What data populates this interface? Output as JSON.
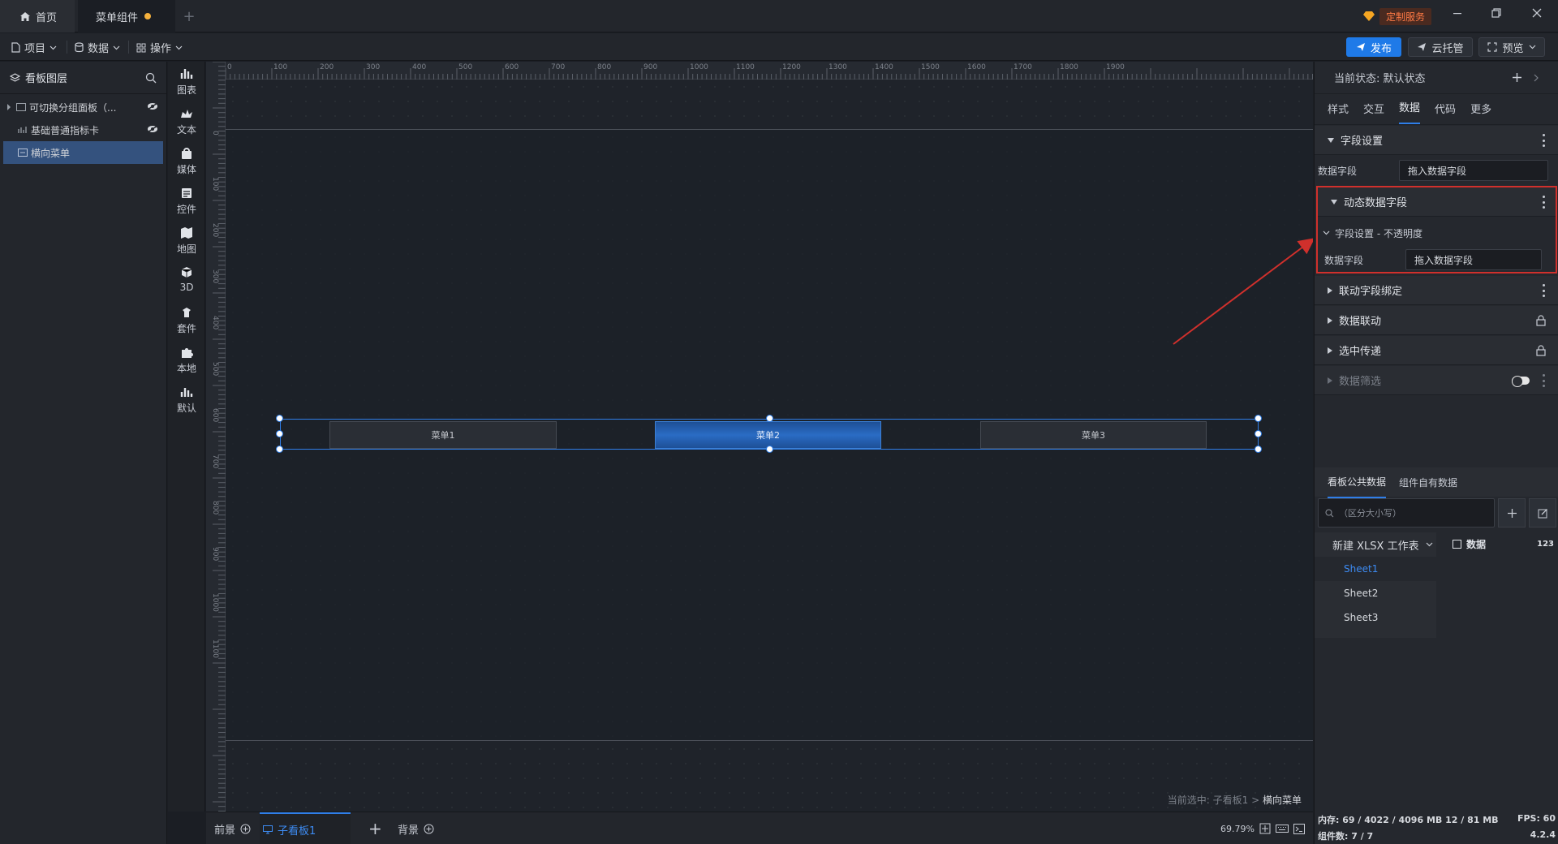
{
  "tabs": {
    "home": "首页",
    "menu": "菜单组件",
    "add": "+"
  },
  "titlebar": {
    "custom_service": "定制服务"
  },
  "toolbar": {
    "project": "项目",
    "data": "数据",
    "operate": "操作",
    "publish": "发布",
    "cloud": "云托管",
    "preview": "预览"
  },
  "layers": {
    "title": "看板图层",
    "items": [
      {
        "label": "可切换分组面板（..."
      },
      {
        "label": "基础普通指标卡"
      },
      {
        "label": "横向菜单"
      }
    ]
  },
  "rail": {
    "items": [
      {
        "label": "图表",
        "icon": "bar-chart-icon"
      },
      {
        "label": "文本",
        "icon": "text-icon"
      },
      {
        "label": "媒体",
        "icon": "media-icon"
      },
      {
        "label": "控件",
        "icon": "control-icon"
      },
      {
        "label": "地图",
        "icon": "map-icon"
      },
      {
        "label": "3D",
        "icon": "cube-icon"
      },
      {
        "label": "套件",
        "icon": "kit-icon"
      },
      {
        "label": "本地",
        "icon": "puzzle-icon"
      },
      {
        "label": "默认",
        "icon": "default-chart-icon"
      }
    ]
  },
  "ruler": {
    "top": [
      "0",
      "100",
      "200",
      "300",
      "400",
      "500",
      "600",
      "700",
      "800",
      "900",
      "1000",
      "1100",
      "1200",
      "1300",
      "1400",
      "1500",
      "1600",
      "1700",
      "1800",
      "1900"
    ],
    "left": [
      "0",
      "100",
      "200",
      "300",
      "400",
      "500",
      "600",
      "700",
      "800",
      "900",
      "1000",
      "1100"
    ]
  },
  "canvas": {
    "menu_items": [
      "菜单1",
      "菜单2",
      "菜单3"
    ],
    "active_index": 1,
    "breadcrumb_prefix": "当前选中: 子看板1 > ",
    "breadcrumb_current": "横向菜单"
  },
  "bottom": {
    "foreground": "前景",
    "sub_board": "子看板1",
    "add": "+",
    "background": "背景",
    "zoom": "69.79%"
  },
  "right": {
    "state_label": "当前状态: 默认状态",
    "tabs": [
      "样式",
      "交互",
      "数据",
      "代码",
      "更多"
    ],
    "active_tab": "数据",
    "field_settings": "字段设置",
    "data_field_label": "数据字段",
    "data_field_placeholder": "拖入数据字段",
    "dynamic_fields": "动态数据字段",
    "opacity_settings": "字段设置 - 不透明度",
    "dyn_field_label": "数据字段",
    "dyn_field_placeholder": "拖入数据字段",
    "linkage_binding": "联动字段绑定",
    "data_linkage": "数据联动",
    "selection_pass": "选中传递",
    "data_filter": "数据筛选",
    "ds_tabs": [
      "看板公共数据",
      "组件自有数据"
    ],
    "search_placeholder": "（区分大小写）",
    "workbook": "新建 XLSX 工作表",
    "sheets": [
      "Sheet1",
      "Sheet2",
      "Sheet3"
    ],
    "data_label": "数据",
    "data_type": "123",
    "memory": "内存: 69 / 4022 / 4096 MB  12 / 81 MB",
    "fps": "FPS: 60",
    "components": "组件数: 7 / 7",
    "version": "4.2.4"
  }
}
